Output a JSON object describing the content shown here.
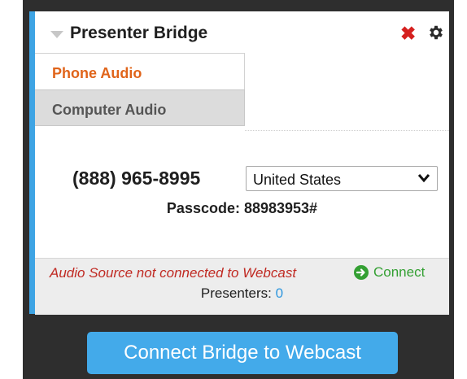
{
  "panel": {
    "title": "Presenter Bridge",
    "tabs": [
      {
        "label": "Phone Audio",
        "active": true
      },
      {
        "label": "Computer Audio",
        "active": false
      }
    ],
    "phone_number": "(888) 965-8995",
    "country_select": {
      "selected": "United States"
    },
    "passcode": "Passcode: 88983953#",
    "status_message": "Audio Source not connected to Webcast",
    "connect_link": "Connect",
    "presenters_label": "Presenters:",
    "presenters_count": "0"
  },
  "footer": {
    "button_label": "Connect Bridge to Webcast"
  },
  "icons": {
    "collapse": "caret-down-icon",
    "close": "close-icon",
    "settings": "gear-icon",
    "dropdown": "chevron-down-icon",
    "connect": "arrow-circle-icon"
  },
  "colors": {
    "accent_bar": "#3ea4e4",
    "active_tab_text": "#e0641a",
    "error_text": "#c02a23",
    "connect_green": "#34a033",
    "button_blue": "#43aaea"
  }
}
